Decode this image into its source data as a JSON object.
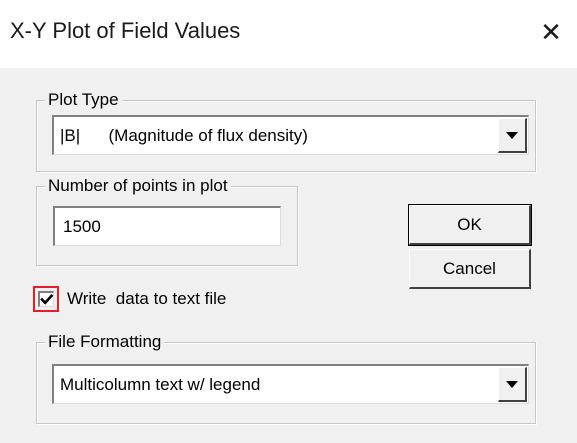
{
  "window": {
    "title": "X-Y Plot of Field Values",
    "close_label": "✕"
  },
  "plot_type": {
    "group_label": "Plot Type",
    "selected": "|B|      (Magnitude of flux density)"
  },
  "points": {
    "group_label": "Number of points in plot",
    "value": "1500"
  },
  "buttons": {
    "ok": "OK",
    "cancel": "Cancel"
  },
  "write_data": {
    "label": "Write  data to text file",
    "checked": true
  },
  "file_formatting": {
    "group_label": "File Formatting",
    "selected": "Multicolumn text w/ legend"
  }
}
